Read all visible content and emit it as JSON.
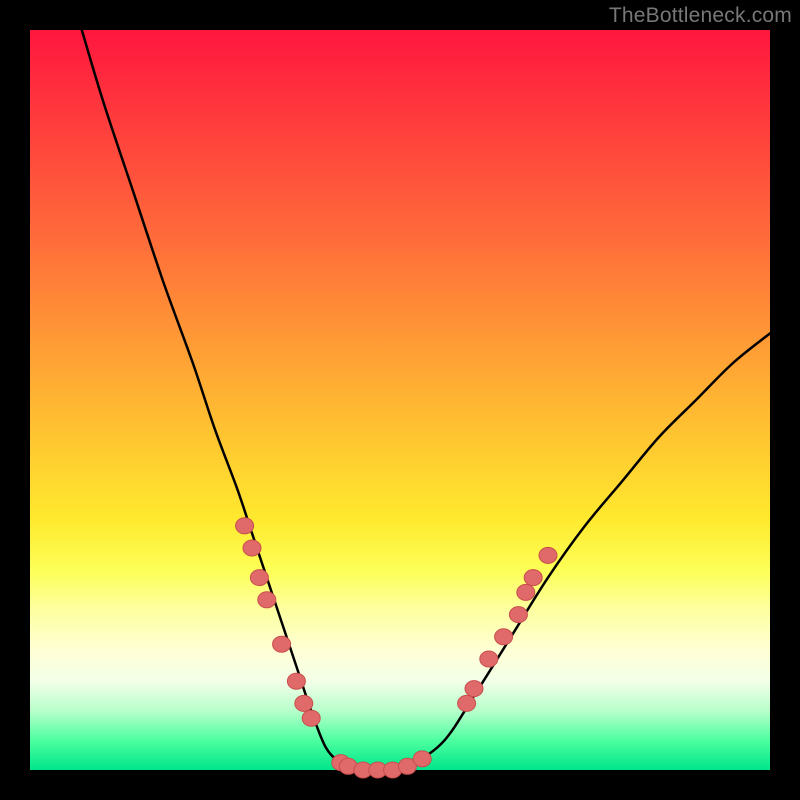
{
  "watermark": "TheBottleneck.com",
  "colors": {
    "frame": "#000000",
    "curve_stroke": "#000000",
    "marker_fill": "#e06a6a",
    "marker_stroke": "#c94d4d"
  },
  "chart_data": {
    "type": "line",
    "title": "",
    "xlabel": "",
    "ylabel": "",
    "xlim": [
      0,
      100
    ],
    "ylim": [
      0,
      100
    ],
    "grid": false,
    "legend": false,
    "series": [
      {
        "name": "bottleneck-curve",
        "x": [
          7,
          10,
          14,
          18,
          22,
          25,
          28,
          30,
          32,
          34,
          36,
          38,
          40,
          42,
          44,
          46,
          49,
          52,
          56,
          60,
          65,
          70,
          75,
          80,
          85,
          90,
          95,
          100
        ],
        "y": [
          100,
          90,
          78,
          66,
          55,
          46,
          38,
          32,
          26,
          20,
          14,
          8,
          3,
          1,
          0,
          0,
          0,
          1,
          4,
          10,
          18,
          26,
          33,
          39,
          45,
          50,
          55,
          59
        ]
      }
    ],
    "markers": [
      {
        "name": "left-cluster",
        "x": 29,
        "y": 33
      },
      {
        "name": "left-cluster",
        "x": 30,
        "y": 30
      },
      {
        "name": "left-cluster",
        "x": 31,
        "y": 26
      },
      {
        "name": "left-cluster",
        "x": 32,
        "y": 23
      },
      {
        "name": "left-cluster",
        "x": 34,
        "y": 17
      },
      {
        "name": "left-cluster",
        "x": 36,
        "y": 12
      },
      {
        "name": "left-cluster",
        "x": 37,
        "y": 9
      },
      {
        "name": "left-cluster",
        "x": 38,
        "y": 7
      },
      {
        "name": "bottom-run",
        "x": 42,
        "y": 1
      },
      {
        "name": "bottom-run",
        "x": 43,
        "y": 0.5
      },
      {
        "name": "bottom-run",
        "x": 45,
        "y": 0
      },
      {
        "name": "bottom-run",
        "x": 47,
        "y": 0
      },
      {
        "name": "bottom-run",
        "x": 49,
        "y": 0
      },
      {
        "name": "bottom-run",
        "x": 51,
        "y": 0.5
      },
      {
        "name": "bottom-run",
        "x": 53,
        "y": 1.5
      },
      {
        "name": "right-cluster",
        "x": 59,
        "y": 9
      },
      {
        "name": "right-cluster",
        "x": 60,
        "y": 11
      },
      {
        "name": "right-cluster",
        "x": 62,
        "y": 15
      },
      {
        "name": "right-cluster",
        "x": 64,
        "y": 18
      },
      {
        "name": "right-cluster",
        "x": 66,
        "y": 21
      },
      {
        "name": "right-cluster",
        "x": 67,
        "y": 24
      },
      {
        "name": "right-cluster",
        "x": 68,
        "y": 26
      },
      {
        "name": "right-cluster",
        "x": 70,
        "y": 29
      }
    ]
  }
}
